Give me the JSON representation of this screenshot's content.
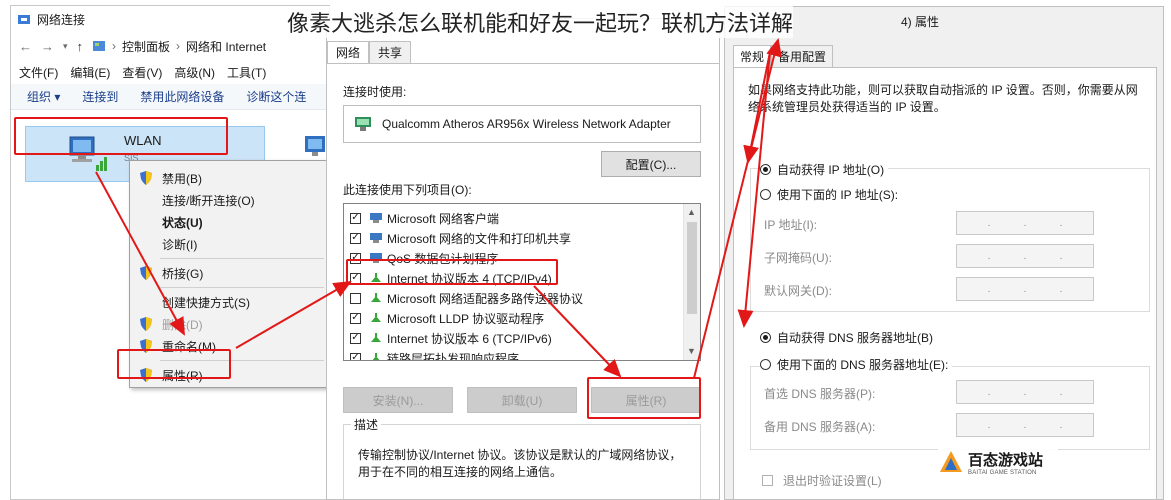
{
  "headline": "像素大逃杀怎么联机能和好友一起玩？联机方法详解",
  "left_window": {
    "title": "网络连接",
    "breadcrumb": [
      "控制面板",
      "网络和 Internet"
    ],
    "menu": [
      "文件(F)",
      "编辑(E)",
      "查看(V)",
      "高级(N)",
      "工具(T)"
    ],
    "commands": [
      "组织 ▾",
      "连接到",
      "禁用此网络设备",
      "诊断这个连"
    ],
    "wlan": {
      "name": "WLAN",
      "sub": "SIS"
    },
    "context_menu": [
      {
        "label": "禁用(B)",
        "shield": true,
        "bold": false,
        "disabled": false
      },
      {
        "label": "连接/断开连接(O)",
        "shield": false,
        "bold": false,
        "disabled": false
      },
      {
        "label": "状态(U)",
        "shield": false,
        "bold": true,
        "disabled": false
      },
      {
        "label": "诊断(I)",
        "shield": false,
        "bold": false,
        "disabled": false
      },
      {
        "label": "桥接(G)",
        "shield": true,
        "bold": false,
        "disabled": false
      },
      {
        "label": "创建快捷方式(S)",
        "shield": false,
        "bold": false,
        "disabled": false
      },
      {
        "label": "删除(D)",
        "shield": true,
        "bold": false,
        "disabled": true
      },
      {
        "label": "重命名(M)",
        "shield": true,
        "bold": false,
        "disabled": false
      },
      {
        "label": "属性(R)",
        "shield": true,
        "bold": false,
        "disabled": false
      }
    ]
  },
  "mid_window": {
    "tabs": [
      "网络",
      "共享"
    ],
    "connect_using_label": "连接时使用:",
    "adapter": "Qualcomm Atheros AR956x Wireless Network Adapter",
    "configure_button": "配置(C)...",
    "items_label": "此连接使用下列项目(O):",
    "items": [
      {
        "label": "Microsoft 网络客户端",
        "checked": true
      },
      {
        "label": "Microsoft 网络的文件和打印机共享",
        "checked": true
      },
      {
        "label": "QoS 数据包计划程序",
        "checked": true
      },
      {
        "label": "Internet 协议版本 4 (TCP/IPv4)",
        "checked": true
      },
      {
        "label": "Microsoft 网络适配器多路传送器协议",
        "checked": false
      },
      {
        "label": "Microsoft LLDP 协议驱动程序",
        "checked": true
      },
      {
        "label": "Internet 协议版本 6 (TCP/IPv6)",
        "checked": true
      },
      {
        "label": "链路层拓扑发现响应程序",
        "checked": true
      }
    ],
    "install_button": "安装(N)...",
    "uninstall_button": "卸载(U)",
    "properties_button": "属性(R)",
    "description_legend": "描述",
    "description": "传输控制协议/Internet 协议。该协议是默认的广域网络协议，用于在不同的相互连接的网络上通信。"
  },
  "right_window": {
    "title": "4) 属性",
    "tabs": [
      "常规",
      "备用配置"
    ],
    "intro": "如果网络支持此功能，则可以获取自动指派的 IP 设置。否则，你需要从网络系统管理员处获得适当的 IP 设置。",
    "auto_ip": "自动获得 IP 地址(O)",
    "manual_ip": "使用下面的 IP 地址(S):",
    "ip_address": "IP 地址(I):",
    "subnet_mask": "子网掩码(U):",
    "gateway": "默认网关(D):",
    "auto_dns": "自动获得 DNS 服务器地址(B)",
    "manual_dns": "使用下面的 DNS 服务器地址(E):",
    "preferred_dns": "首选 DNS 服务器(P):",
    "alternate_dns": "备用 DNS 服务器(A):",
    "validate_on_exit": "退出时验证设置(L)"
  },
  "watermark": {
    "name": "百态游戏站",
    "sub": "BAITAI GAME STATION"
  },
  "colors": {
    "highlight": "#e21818",
    "selection": "#cce4f7",
    "link": "#1b3f8b"
  }
}
